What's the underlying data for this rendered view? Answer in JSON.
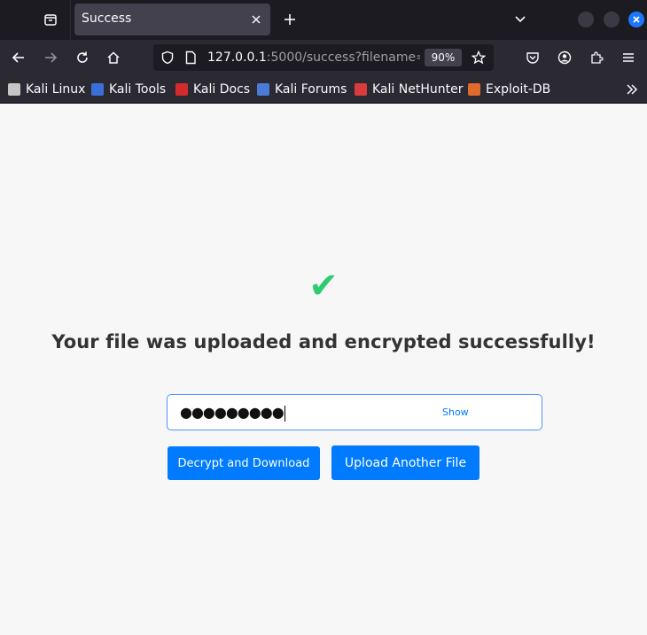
{
  "tab": {
    "title": "Success"
  },
  "navbar": {
    "url_host": "127.0.0.1",
    "url_rest": ":5000/success?filename=",
    "zoom": "90%"
  },
  "bookmarks": [
    {
      "label": "Kali Linux",
      "icon": "kali-linux-icon",
      "color": "#c6c6c6"
    },
    {
      "label": "Kali Tools",
      "icon": "kali-tools-icon",
      "color": "#3b6fd8"
    },
    {
      "label": "Kali Docs",
      "icon": "kali-docs-icon",
      "color": "#d42c2c"
    },
    {
      "label": "Kali Forums",
      "icon": "kali-forums-icon",
      "color": "#4b7bd6"
    },
    {
      "label": "Kali NetHunter",
      "icon": "kali-nethunter-icon",
      "color": "#d93c3c"
    },
    {
      "label": "Exploit-DB",
      "icon": "exploit-db-icon",
      "color": "#e06a2c"
    }
  ],
  "main": {
    "check_glyph": "✔",
    "headline": "Your file was uploaded and encrypted successfully!",
    "password_value": "●●●●●●●●●",
    "show_label": "Show",
    "decrypt_label": "Decrypt and Download",
    "upload_label": "Upload Another File"
  },
  "colors": {
    "accent": "#007bff",
    "success": "#2ecc71"
  }
}
